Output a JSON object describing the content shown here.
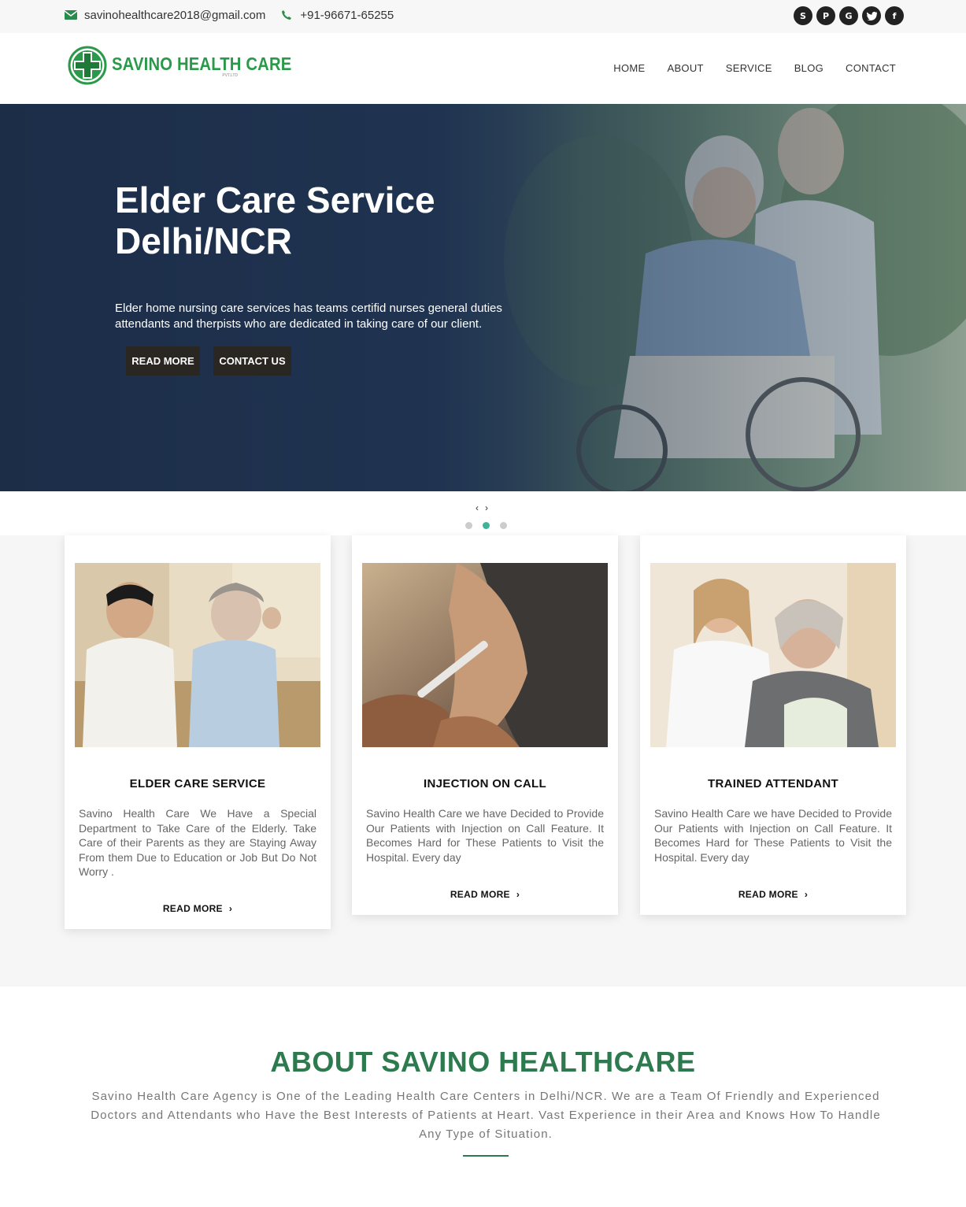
{
  "topbar": {
    "email": "savinohealthcare2018@gmail.com",
    "phone": "+91-96671-65255",
    "social": [
      "skype-icon",
      "pinterest-icon",
      "google-plus-icon",
      "twitter-icon",
      "facebook-icon"
    ]
  },
  "header": {
    "logo_name": "SAVINO HEALTH CARE",
    "logo_sub": "PVT.LTD",
    "nav": [
      "HOME",
      "ABOUT",
      "SERVICE",
      "BLOG",
      "CONTACT"
    ]
  },
  "hero": {
    "title": "Elder Care Service Delhi/NCR",
    "text": "Elder home nursing care services has teams certifid nurses general duties attendants and therpists who are dedicated in taking care of our client.",
    "btn_read_more": "READ MORE",
    "btn_contact": "CONTACT US",
    "prev_arrow": "‹",
    "next_arrow": "›",
    "slides": 3,
    "active_slide": 2
  },
  "services": [
    {
      "title": "ELDER CARE SERVICE",
      "text": "Savino Health Care We Have a Special Department to Take Care of the Elderly. Take Care of their Parents as they are Staying Away From them Due to Education or Job But Do Not Worry .",
      "more": "READ MORE"
    },
    {
      "title": "INJECTION ON CALL",
      "text": "Savino Health Care we have Decided to Provide Our Patients with Injection on Call Feature. It Becomes Hard for These Patients to Visit the Hospital. Every day",
      "more": "READ MORE"
    },
    {
      "title": "TRAINED ATTENDANT",
      "text": "Savino Health Care we have Decided to Provide Our Patients with Injection on Call Feature. It Becomes Hard for These Patients to Visit the Hospital. Every day",
      "more": "READ MORE"
    }
  ],
  "about": {
    "title": "ABOUT SAVINO HEALTHCARE",
    "text": "Savino Health Care Agency is One of the Leading Health Care Centers in Delhi/NCR. We are a Team Of Friendly and Experienced Doctors and Attendants who Have the Best Interests of Patients at Heart. Vast Experience in their Area and Knows How To Handle Any Type of Situation."
  },
  "colors": {
    "brand_green": "#2d7a4e",
    "hero_navy": "#1c2d48",
    "dot_active": "#3fb39a",
    "button_dark": "#2a2622"
  }
}
